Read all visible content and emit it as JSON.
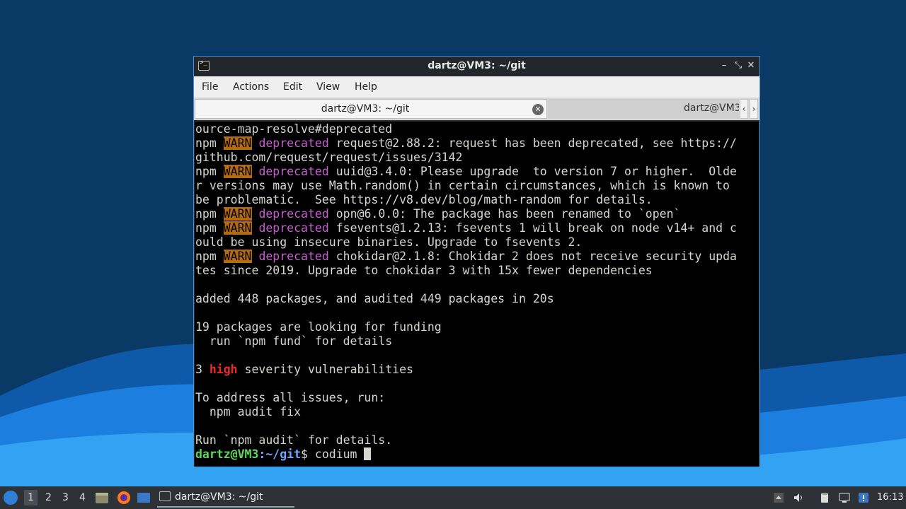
{
  "window": {
    "title": "dartz@VM3: ~/git",
    "controls": {
      "minimize": "–",
      "maximize": "⤡",
      "close": "✕"
    }
  },
  "menu": [
    "File",
    "Actions",
    "Edit",
    "View",
    "Help"
  ],
  "tabs": {
    "active_label": "dartz@VM3: ~/git",
    "inactive_label": "dartz@VM3",
    "scroll_left": "‹",
    "scroll_right": "›",
    "close_glyph": "✕"
  },
  "terminal": {
    "lines": [
      {
        "segs": [
          {
            "t": "ource-map-resolve#deprecated"
          }
        ]
      },
      {
        "segs": [
          {
            "t": "npm "
          },
          {
            "t": "WARN",
            "c": "w"
          },
          {
            "t": " "
          },
          {
            "t": "deprecated",
            "c": "d"
          },
          {
            "t": " request@2.88.2: request has been deprecated, see https://"
          }
        ]
      },
      {
        "segs": [
          {
            "t": "github.com/request/request/issues/3142"
          }
        ]
      },
      {
        "segs": [
          {
            "t": "npm "
          },
          {
            "t": "WARN",
            "c": "w"
          },
          {
            "t": " "
          },
          {
            "t": "deprecated",
            "c": "d"
          },
          {
            "t": " uuid@3.4.0: Please upgrade  to version 7 or higher.  Olde"
          }
        ]
      },
      {
        "segs": [
          {
            "t": "r versions may use Math.random() in certain circumstances, which is known to"
          }
        ]
      },
      {
        "segs": [
          {
            "t": "be problematic.  See https://v8.dev/blog/math-random for details."
          }
        ]
      },
      {
        "segs": [
          {
            "t": "npm "
          },
          {
            "t": "WARN",
            "c": "w"
          },
          {
            "t": " "
          },
          {
            "t": "deprecated",
            "c": "d"
          },
          {
            "t": " opn@6.0.0: The package has been renamed to `open`"
          }
        ]
      },
      {
        "segs": [
          {
            "t": "npm "
          },
          {
            "t": "WARN",
            "c": "w"
          },
          {
            "t": " "
          },
          {
            "t": "deprecated",
            "c": "d"
          },
          {
            "t": " fsevents@1.2.13: fsevents 1 will break on node v14+ and c"
          }
        ]
      },
      {
        "segs": [
          {
            "t": "ould be using insecure binaries. Upgrade to fsevents 2."
          }
        ]
      },
      {
        "segs": [
          {
            "t": "npm "
          },
          {
            "t": "WARN",
            "c": "w"
          },
          {
            "t": " "
          },
          {
            "t": "deprecated",
            "c": "d"
          },
          {
            "t": " chokidar@2.1.8: Chokidar 2 does not receive security upda"
          }
        ]
      },
      {
        "segs": [
          {
            "t": "tes since 2019. Upgrade to chokidar 3 with 15x fewer dependencies"
          }
        ]
      },
      {
        "segs": [
          {
            "t": ""
          }
        ]
      },
      {
        "segs": [
          {
            "t": "added 448 packages, and audited 449 packages in 20s"
          }
        ]
      },
      {
        "segs": [
          {
            "t": ""
          }
        ]
      },
      {
        "segs": [
          {
            "t": "19 packages are looking for funding"
          }
        ]
      },
      {
        "segs": [
          {
            "t": "  run `npm fund` for details"
          }
        ]
      },
      {
        "segs": [
          {
            "t": ""
          }
        ]
      },
      {
        "segs": [
          {
            "t": "3 "
          },
          {
            "t": "high",
            "c": "h"
          },
          {
            "t": " severity vulnerabilities"
          }
        ]
      },
      {
        "segs": [
          {
            "t": ""
          }
        ]
      },
      {
        "segs": [
          {
            "t": "To address all issues, run:"
          }
        ]
      },
      {
        "segs": [
          {
            "t": "  npm audit fix"
          }
        ]
      },
      {
        "segs": [
          {
            "t": ""
          }
        ]
      },
      {
        "segs": [
          {
            "t": "Run `npm audit` for details."
          }
        ]
      }
    ],
    "prompt_user": "dartz@VM3",
    "prompt_sep": ":",
    "prompt_path": "~/git",
    "prompt_symbol": "$",
    "command": " codium "
  },
  "taskbar": {
    "workspaces": [
      "1",
      "2",
      "3",
      "4"
    ],
    "task_label": "dartz@VM3: ~/git",
    "clock": "16:13"
  },
  "colors": {
    "warn_bg": "#b36a10",
    "deprecated": "#c75fd1",
    "high": "#ef2929",
    "prompt_user": "#5fd75f",
    "prompt_path": "#6ea5ff"
  }
}
